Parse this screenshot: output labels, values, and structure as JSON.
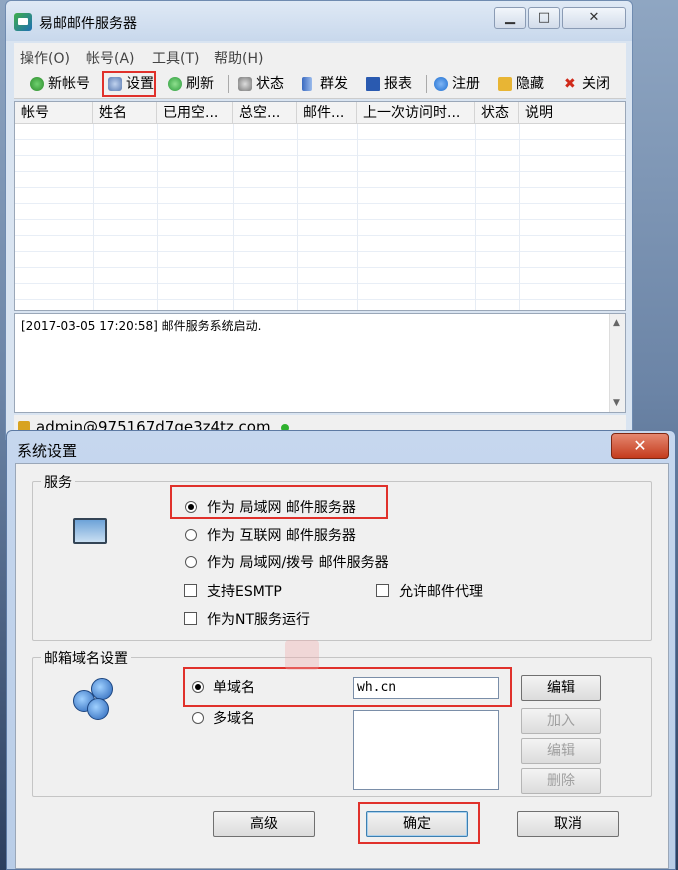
{
  "main_window": {
    "title": "易邮邮件服务器",
    "controls": {
      "minimize": "▁",
      "maximize": "□",
      "close": "✕"
    },
    "menu": [
      "操作(O)",
      "帐号(A)",
      "工具(T)",
      "帮助(H)"
    ],
    "toolbar": [
      {
        "label": "新帐号",
        "icon": "globe-icon",
        "color": "#2a8a2a"
      },
      {
        "label": "设置",
        "icon": "gear-icon",
        "color": "#5b7cb3"
      },
      {
        "label": "刷新",
        "icon": "refresh-icon",
        "color": "#2a9a3a"
      },
      {
        "label": "状态",
        "icon": "status-icon",
        "color": "#6b6b6b"
      },
      {
        "label": "群发",
        "icon": "broadcast-icon",
        "color": "#3a6ac0"
      },
      {
        "label": "报表",
        "icon": "report-icon",
        "color": "#2a5ab0"
      },
      {
        "label": "注册",
        "icon": "info-icon",
        "color": "#1f6fd0"
      },
      {
        "label": "隐藏",
        "icon": "hide-icon",
        "color": "#d9a020"
      },
      {
        "label": "关闭",
        "icon": "close-icon",
        "color": "#d02a1a"
      }
    ],
    "table_headers": [
      "帐号",
      "姓名",
      "已用空...",
      "总空...",
      "邮件...",
      "上一次访问时...",
      "状态",
      "说明"
    ],
    "log": "[2017-03-05 17:20:58] 邮件服务系统启动.",
    "status_user": "admin@975167d7ge3z4tz.com"
  },
  "dialog": {
    "title": "系统设置",
    "close": "✕",
    "service_group": {
      "label": "服务",
      "options": [
        "作为 局域网 邮件服务器",
        "作为 互联网 邮件服务器",
        "作为 局域网/拨号 邮件服务器"
      ],
      "selected": 0,
      "checkboxes": [
        "支持ESMTP",
        "允许邮件代理",
        "作为NT服务运行"
      ]
    },
    "domain_group": {
      "label": "邮箱域名设置",
      "single": "单域名",
      "multi": "多域名",
      "domain_value": "wh.cn",
      "btn_edit_single": "编辑",
      "btn_add": "加入",
      "btn_edit": "编辑",
      "btn_delete": "删除"
    },
    "buttons": {
      "advanced": "高级",
      "ok": "确定",
      "cancel": "取消"
    }
  },
  "colors": {
    "highlight": "#e0312b",
    "accent": "#3c7fb1"
  }
}
